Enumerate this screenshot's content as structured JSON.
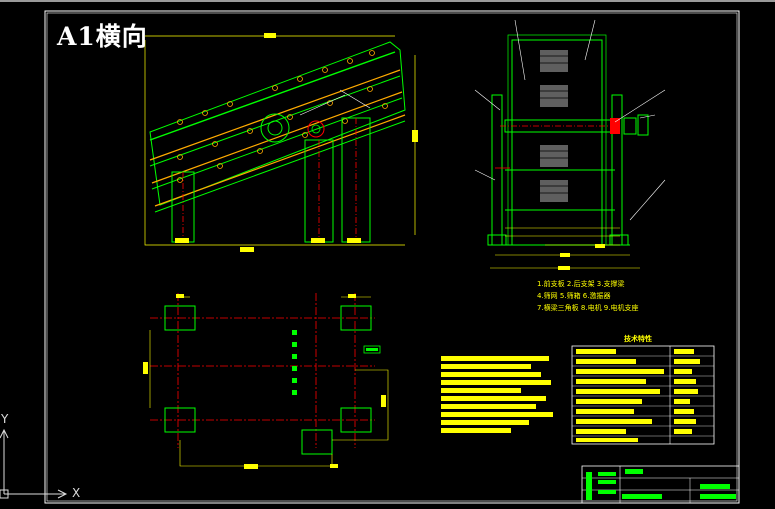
{
  "drawing": {
    "sheet_title": "A1横向",
    "legend_lines": [
      "1.前支板  2.后支架  3.支撑梁",
      "4.筛网    5.筛箱    6.激振器",
      "7.横梁三角板 8.电机  9.电机支座"
    ],
    "tech_table_title": "技术特性",
    "axis_x_label": "X",
    "axis_y_label": "Y"
  },
  "colors": {
    "background": "#000000",
    "frame": "#ffffff",
    "structure": "#00ff00",
    "dimension": "#ffff00",
    "centerline": "#ff0000",
    "accent": "#ff00ff",
    "leader": "#ffffff"
  }
}
